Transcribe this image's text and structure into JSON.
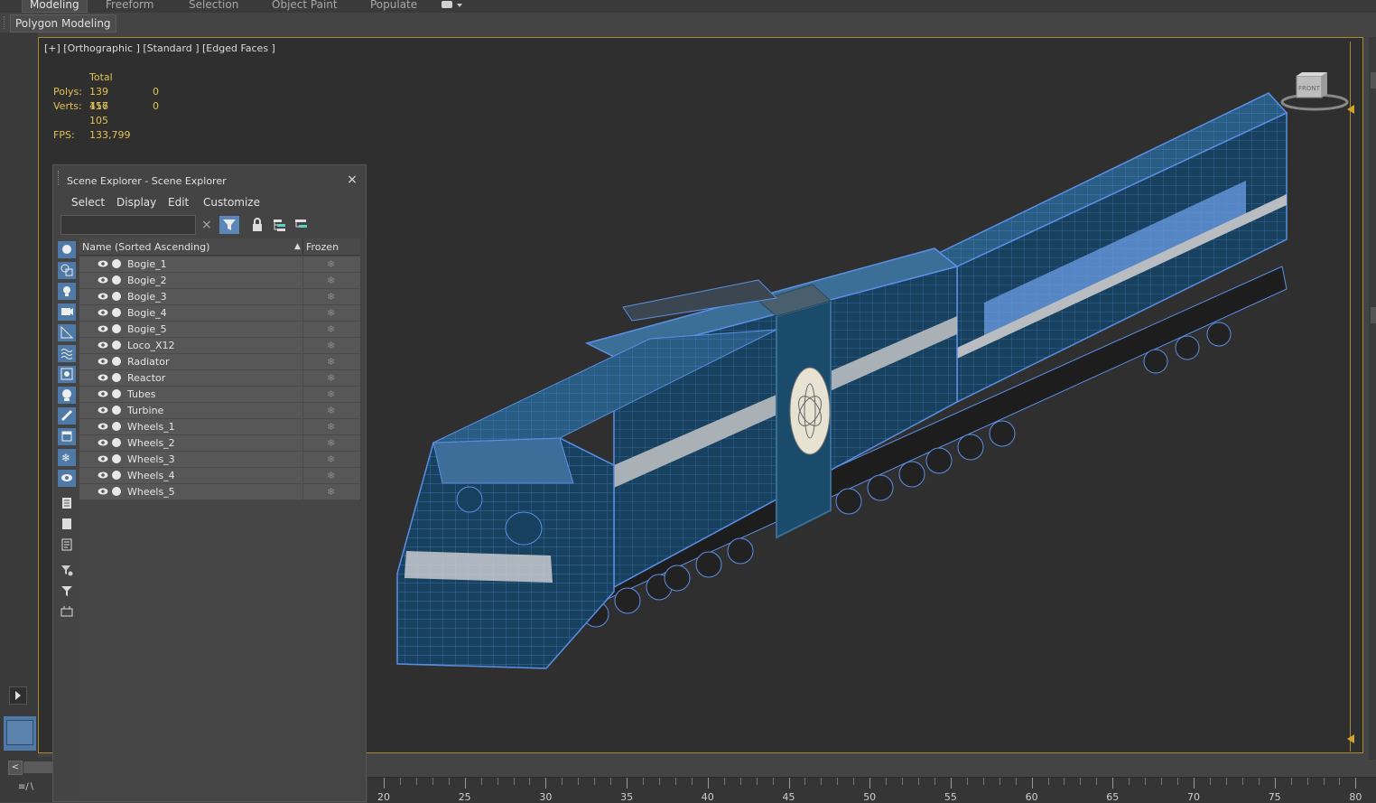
{
  "ribbon": {
    "tabs": [
      {
        "label": "Modeling",
        "active": true
      },
      {
        "label": "Freeform",
        "active": false
      },
      {
        "label": "Selection",
        "active": false
      },
      {
        "label": "Object Paint",
        "active": false
      },
      {
        "label": "Populate",
        "active": false
      }
    ],
    "subtab": "Polygon Modeling"
  },
  "viewport": {
    "label": "[+] [Orthographic ] [Standard ] [Edged Faces ]",
    "stats": {
      "header": "Total",
      "polys_label": "Polys:",
      "polys_total": "139 416",
      "polys_sel": "0",
      "verts_label": "Verts:",
      "verts_total": "157 105",
      "verts_sel": "0",
      "fps_label": "FPS:",
      "fps_value": "133,799"
    },
    "viewcube_face": "FRONT"
  },
  "scene_explorer": {
    "title": "Scene Explorer - Scene Explorer",
    "close": "×",
    "menu": [
      "Select",
      "Display",
      "Edit",
      "Customize"
    ],
    "search_value": "",
    "columns": {
      "name": "Name (Sorted Ascending)",
      "frozen": "Frozen",
      "sort_indicator": "▲"
    },
    "clear_icon": "×",
    "frozen_icon": "❄",
    "objects": [
      "Bogie_1",
      "Bogie_2",
      "Bogie_3",
      "Bogie_4",
      "Bogie_5",
      "Loco_X12",
      "Radiator",
      "Reactor",
      "Tubes",
      "Turbine",
      "Wheels_1",
      "Wheels_2",
      "Wheels_3",
      "Wheels_4",
      "Wheels_5"
    ]
  },
  "timeline": {
    "labels": [
      "20",
      "25",
      "30",
      "35",
      "40",
      "45",
      "50",
      "55",
      "60",
      "65",
      "70",
      "75",
      "80"
    ]
  },
  "colors": {
    "accent": "#5a86b8",
    "viewport_border": "#a88a2f",
    "stats_text": "#e3c24f",
    "wire": "#5b8fe6",
    "body_dark": "#17415e"
  }
}
